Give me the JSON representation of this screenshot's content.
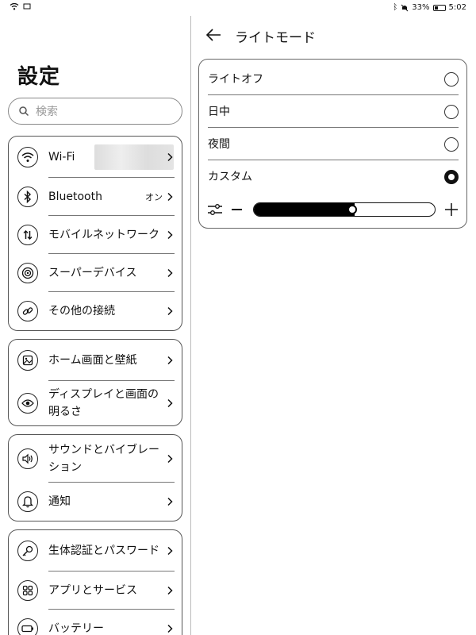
{
  "status_bar": {
    "battery_percent": "33%",
    "time": "5:02",
    "battery_level": 0.33
  },
  "settings": {
    "title": "設定",
    "search_placeholder": "検索",
    "groups": [
      {
        "items": [
          {
            "label": "Wi-Fi",
            "value": "",
            "icon": "wifi-icon"
          },
          {
            "label": "Bluetooth",
            "value": "オン",
            "icon": "bluetooth-icon"
          },
          {
            "label": "モバイルネットワーク",
            "value": "",
            "icon": "mobile-network-icon"
          },
          {
            "label": "スーパーデバイス",
            "value": "",
            "icon": "super-device-icon"
          },
          {
            "label": "その他の接続",
            "value": "",
            "icon": "link-icon"
          }
        ]
      },
      {
        "items": [
          {
            "label": "ホーム画面と壁紙",
            "value": "",
            "icon": "wallpaper-icon"
          },
          {
            "label": "ディスプレイと画面の明るさ",
            "value": "",
            "icon": "eye-icon"
          }
        ]
      },
      {
        "items": [
          {
            "label": "サウンドとバイブレーション",
            "value": "",
            "icon": "speaker-icon"
          },
          {
            "label": "通知",
            "value": "",
            "icon": "bell-icon"
          }
        ]
      },
      {
        "items": [
          {
            "label": "生体認証とパスワード",
            "value": "",
            "icon": "key-icon"
          },
          {
            "label": "アプリとサービス",
            "value": "",
            "icon": "apps-grid-icon"
          },
          {
            "label": "バッテリー",
            "value": "",
            "icon": "battery-icon"
          }
        ]
      }
    ]
  },
  "light_mode": {
    "title": "ライトモード",
    "options": [
      {
        "label": "ライトオフ",
        "selected": false
      },
      {
        "label": "日中",
        "selected": false
      },
      {
        "label": "夜間",
        "selected": false
      },
      {
        "label": "カスタム",
        "selected": true
      }
    ],
    "brightness_level": 0.55
  }
}
